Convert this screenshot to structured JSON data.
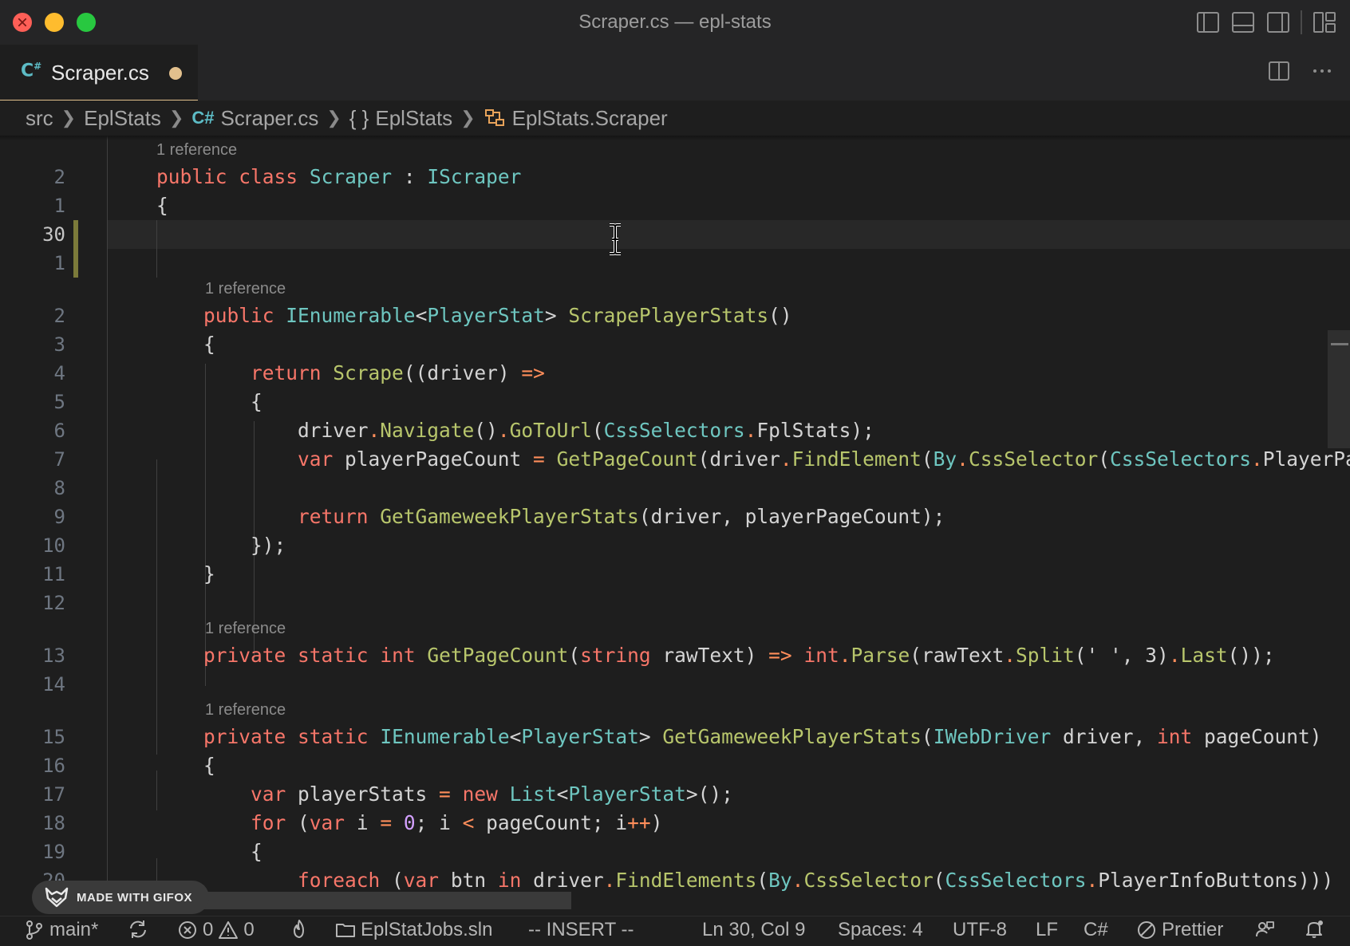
{
  "window": {
    "title": "Scraper.cs — epl-stats"
  },
  "tab": {
    "label": "Scraper.cs",
    "icon": "C#"
  },
  "breadcrumb": [
    {
      "label": "src"
    },
    {
      "label": "EplStats"
    },
    {
      "label": "Scraper.cs",
      "icon": "C#"
    },
    {
      "label": "EplStats",
      "icon": "{ }"
    },
    {
      "label": "EplStats.Scraper",
      "icon": "class-icon"
    }
  ],
  "editor": {
    "reference_text": "1 reference",
    "line_numbers": [
      "2",
      "1",
      "30",
      "1",
      "2",
      "3",
      "4",
      "5",
      "6",
      "7",
      "8",
      "9",
      "10",
      "11",
      "12",
      "13",
      "14",
      "15",
      "16",
      "17",
      "18",
      "19",
      "20"
    ],
    "active_line": "30"
  },
  "statusbar": {
    "branch": "main*",
    "errors": "0",
    "warnings": "0",
    "solution": "EplStatJobs.sln",
    "mode": "-- INSERT --",
    "position": "Ln 30, Col 9",
    "spaces": "Spaces: 4",
    "encoding": "UTF-8",
    "eol": "LF",
    "language": "C#",
    "formatter": "Prettier"
  },
  "badge": {
    "text": "MADE WITH GIFOX"
  },
  "colors": {
    "tab_modified": "#e2c08d",
    "keyword": "#f77669",
    "type": "#6ec6c0",
    "function": "#b8c66c",
    "operator": "#ff8e5b"
  }
}
